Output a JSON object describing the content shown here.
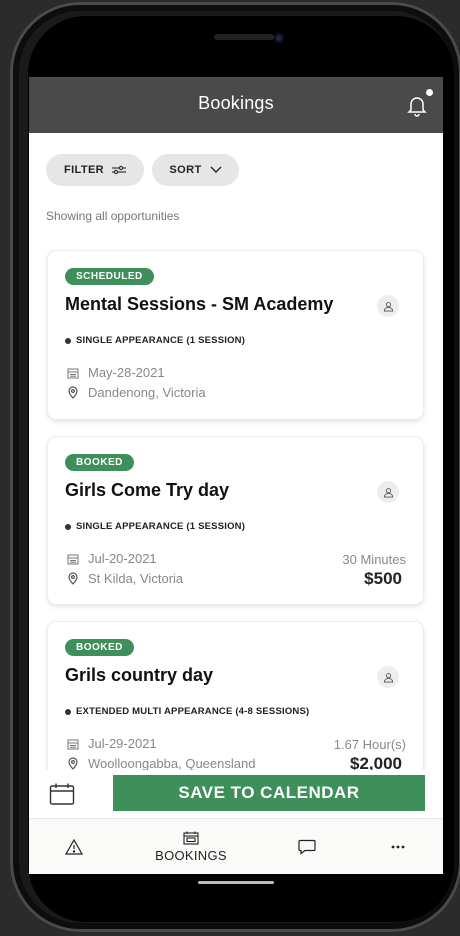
{
  "header": {
    "title": "Bookings"
  },
  "toolbar": {
    "filter_label": "FILTER",
    "sort_label": "SORT"
  },
  "status_text": "Showing all opportunities",
  "bookings": [
    {
      "status": "SCHEDULED",
      "title": "Mental Sessions - SM Academy",
      "type": "SINGLE APPEARANCE (1 SESSION)",
      "date": "May-28-2021",
      "location": "Dandenong, Victoria",
      "duration": "",
      "price": ""
    },
    {
      "status": "BOOKED",
      "title": "Girls Come Try day",
      "type": "SINGLE APPEARANCE (1 SESSION)",
      "date": "Jul-20-2021",
      "location": "St Kilda, Victoria",
      "duration": "30 Minutes",
      "price": "$500"
    },
    {
      "status": "BOOKED",
      "title": "Grils country day",
      "type": "EXTENDED MULTI APPEARANCE (4-8 SESSIONS)",
      "date": "Jul-29-2021",
      "location": "Woolloongabba, Queensland",
      "duration": "1.67 Hour(s)",
      "price": "$2,000"
    }
  ],
  "actions": {
    "save_label": "SAVE TO CALENDAR"
  },
  "tabbar": {
    "bookings_label": "BOOKINGS"
  },
  "colors": {
    "header": "#4a4a4a",
    "accent": "#3f8f5a",
    "pill": "#e6e6e6"
  },
  "icons": [
    "bell-icon",
    "filter-icon",
    "chevron-down-icon",
    "user-icon",
    "calendar-icon",
    "location-pin-icon",
    "warning-icon",
    "chat-icon",
    "more-icon"
  ]
}
